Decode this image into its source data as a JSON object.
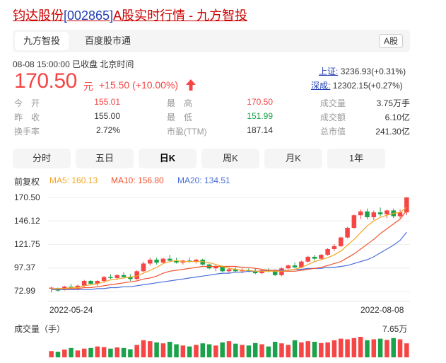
{
  "header": {
    "title_name": "钧达股份",
    "title_code": "[002865]",
    "title_rest": "A股实时行情 - 九方智投"
  },
  "tabs": [
    {
      "label": "九方智投",
      "active": true
    },
    {
      "label": "百度股市通",
      "active": false
    }
  ],
  "market_badge": "A股",
  "status": "08-08 15:00:00  已收盘  北京时间",
  "quote": {
    "price": "170.50",
    "unit": "元",
    "change": "+15.50 (+10.00%)",
    "up_color": "#f54545",
    "down_color": "#1aa34a"
  },
  "indices": [
    {
      "name": "上证:",
      "value": "3236.93(+0.31%)"
    },
    {
      "name": "深成:",
      "value": "12302.15(+0.27%)"
    }
  ],
  "stats": [
    {
      "label": "今　开",
      "value": "155.01",
      "tone": "up"
    },
    {
      "label": "最　高",
      "value": "170.50",
      "tone": "up"
    },
    {
      "label": "成交量",
      "value": "3.75万手",
      "tone": "neutral"
    },
    {
      "label": "昨　收",
      "value": "155.00",
      "tone": "neutral"
    },
    {
      "label": "最　低",
      "value": "151.99",
      "tone": "down"
    },
    {
      "label": "成交额",
      "value": "6.10亿",
      "tone": "neutral"
    },
    {
      "label": "换手率",
      "value": "2.72%",
      "tone": "neutral"
    },
    {
      "label": "市盈(TTM)",
      "value": "187.14",
      "tone": "neutral"
    },
    {
      "label": "总市值",
      "value": "241.30亿",
      "tone": "neutral"
    }
  ],
  "periods": [
    {
      "label": "分时",
      "active": false
    },
    {
      "label": "五日",
      "active": false
    },
    {
      "label": "日K",
      "active": true
    },
    {
      "label": "周K",
      "active": false
    },
    {
      "label": "月K",
      "active": false
    },
    {
      "label": "1年",
      "active": false
    }
  ],
  "ma_legend": {
    "adjust": "前复权",
    "ma5": "MA5: 160.13",
    "ma10": "MA10: 156.80",
    "ma20": "MA20: 134.51",
    "ma5_color": "#f5a623",
    "ma10_color": "#f0522f",
    "ma20_color": "#4a6fd8"
  },
  "chart_data": {
    "type": "candlestick",
    "y_ticks": [
      "170.50",
      "146.12",
      "121.75",
      "97.37",
      "72.99"
    ],
    "ylim": [
      72.99,
      170.5
    ],
    "x_ticks": [
      "2022-05-24",
      "2022-08-08"
    ],
    "candles": [
      {
        "o": 76,
        "h": 78,
        "l": 72,
        "c": 77
      },
      {
        "o": 76,
        "h": 77,
        "l": 73,
        "c": 74
      },
      {
        "o": 75,
        "h": 79,
        "l": 74,
        "c": 78
      },
      {
        "o": 78,
        "h": 81,
        "l": 76,
        "c": 77
      },
      {
        "o": 77,
        "h": 80,
        "l": 75,
        "c": 79
      },
      {
        "o": 79,
        "h": 85,
        "l": 78,
        "c": 84
      },
      {
        "o": 84,
        "h": 85,
        "l": 80,
        "c": 81
      },
      {
        "o": 81,
        "h": 85,
        "l": 79,
        "c": 84
      },
      {
        "o": 84,
        "h": 89,
        "l": 82,
        "c": 88
      },
      {
        "o": 88,
        "h": 91,
        "l": 86,
        "c": 87
      },
      {
        "o": 87,
        "h": 91,
        "l": 85,
        "c": 90
      },
      {
        "o": 90,
        "h": 93,
        "l": 87,
        "c": 88
      },
      {
        "o": 88,
        "h": 91,
        "l": 84,
        "c": 86
      },
      {
        "o": 86,
        "h": 95,
        "l": 85,
        "c": 94
      },
      {
        "o": 94,
        "h": 104,
        "l": 93,
        "c": 102
      },
      {
        "o": 102,
        "h": 108,
        "l": 100,
        "c": 106
      },
      {
        "o": 106,
        "h": 108,
        "l": 101,
        "c": 103
      },
      {
        "o": 103,
        "h": 108,
        "l": 102,
        "c": 107
      },
      {
        "o": 107,
        "h": 111,
        "l": 104,
        "c": 105
      },
      {
        "o": 105,
        "h": 108,
        "l": 102,
        "c": 103
      },
      {
        "o": 103,
        "h": 106,
        "l": 101,
        "c": 105
      },
      {
        "o": 105,
        "h": 108,
        "l": 103,
        "c": 104
      },
      {
        "o": 104,
        "h": 107,
        "l": 102,
        "c": 106
      },
      {
        "o": 106,
        "h": 107,
        "l": 100,
        "c": 101
      },
      {
        "o": 101,
        "h": 102,
        "l": 96,
        "c": 97
      },
      {
        "o": 97,
        "h": 101,
        "l": 94,
        "c": 99
      },
      {
        "o": 99,
        "h": 100,
        "l": 93,
        "c": 94
      },
      {
        "o": 94,
        "h": 98,
        "l": 92,
        "c": 96
      },
      {
        "o": 96,
        "h": 98,
        "l": 93,
        "c": 94
      },
      {
        "o": 94,
        "h": 97,
        "l": 92,
        "c": 95
      },
      {
        "o": 95,
        "h": 97,
        "l": 93,
        "c": 94
      },
      {
        "o": 94,
        "h": 97,
        "l": 91,
        "c": 92
      },
      {
        "o": 92,
        "h": 96,
        "l": 91,
        "c": 95
      },
      {
        "o": 95,
        "h": 97,
        "l": 93,
        "c": 94
      },
      {
        "o": 94,
        "h": 96,
        "l": 89,
        "c": 90
      },
      {
        "o": 90,
        "h": 98,
        "l": 89,
        "c": 97
      },
      {
        "o": 97,
        "h": 101,
        "l": 96,
        "c": 100
      },
      {
        "o": 100,
        "h": 103,
        "l": 97,
        "c": 98
      },
      {
        "o": 98,
        "h": 105,
        "l": 97,
        "c": 104
      },
      {
        "o": 104,
        "h": 110,
        "l": 103,
        "c": 109
      },
      {
        "o": 109,
        "h": 111,
        "l": 105,
        "c": 107
      },
      {
        "o": 107,
        "h": 112,
        "l": 106,
        "c": 111
      },
      {
        "o": 111,
        "h": 118,
        "l": 110,
        "c": 117
      },
      {
        "o": 117,
        "h": 122,
        "l": 115,
        "c": 120
      },
      {
        "o": 120,
        "h": 130,
        "l": 119,
        "c": 129
      },
      {
        "o": 129,
        "h": 140,
        "l": 128,
        "c": 139
      },
      {
        "o": 139,
        "h": 153,
        "l": 138,
        "c": 152
      },
      {
        "o": 152,
        "h": 158,
        "l": 148,
        "c": 156
      },
      {
        "o": 156,
        "h": 159,
        "l": 148,
        "c": 150
      },
      {
        "o": 150,
        "h": 157,
        "l": 147,
        "c": 155
      },
      {
        "o": 155,
        "h": 160,
        "l": 151,
        "c": 153
      },
      {
        "o": 153,
        "h": 158,
        "l": 149,
        "c": 157
      },
      {
        "o": 157,
        "h": 159,
        "l": 149,
        "c": 151
      },
      {
        "o": 151,
        "h": 158,
        "l": 149,
        "c": 155
      },
      {
        "o": 155,
        "h": 170.5,
        "l": 151.99,
        "c": 170.5
      }
    ],
    "ma5": [
      76,
      76,
      76,
      77,
      77,
      79,
      80,
      81,
      83,
      85,
      86,
      87,
      88,
      89,
      92,
      95,
      98,
      102,
      104,
      105,
      104,
      104,
      104,
      104,
      103,
      101,
      99,
      97,
      96,
      95,
      95,
      94,
      94,
      94,
      94,
      94,
      95,
      96,
      98,
      101,
      104,
      106,
      108,
      111,
      115,
      121,
      127,
      134,
      141,
      146,
      150,
      152,
      154,
      155,
      160.13
    ],
    "ma10": [
      76,
      76,
      76,
      76,
      76,
      77,
      77,
      78,
      79,
      80,
      81,
      82,
      83,
      84,
      86,
      87,
      89,
      92,
      94,
      95,
      96,
      97,
      98,
      99,
      99,
      99,
      99,
      99,
      99,
      98,
      98,
      97,
      96,
      95,
      95,
      94,
      94,
      94,
      95,
      96,
      97,
      98,
      100,
      102,
      104,
      108,
      112,
      117,
      122,
      127,
      133,
      138,
      143,
      148,
      156.8
    ],
    "ma20": [
      75,
      75,
      75,
      75,
      75,
      75,
      75,
      76,
      76,
      77,
      77,
      78,
      78,
      79,
      80,
      81,
      82,
      83,
      84,
      85,
      86,
      87,
      88,
      89,
      90,
      91,
      92,
      92,
      93,
      93,
      94,
      94,
      94,
      95,
      95,
      95,
      95,
      96,
      96,
      97,
      97,
      97,
      98,
      98,
      99,
      100,
      102,
      104,
      106,
      109,
      113,
      117,
      121,
      126,
      134.51
    ],
    "volume": {
      "label": "成交量（手）",
      "max_label": "7.65万",
      "values": [
        20,
        18,
        25,
        30,
        22,
        28,
        30,
        35,
        33,
        28,
        32,
        30,
        26,
        40,
        55,
        52,
        48,
        45,
        50,
        42,
        38,
        35,
        40,
        45,
        42,
        38,
        48,
        52,
        44,
        40,
        38,
        46,
        42,
        35,
        50,
        45,
        40,
        55,
        48,
        52,
        50,
        46,
        48,
        55,
        60,
        58,
        62,
        66,
        55,
        58,
        60,
        56,
        62,
        58,
        45
      ]
    }
  }
}
